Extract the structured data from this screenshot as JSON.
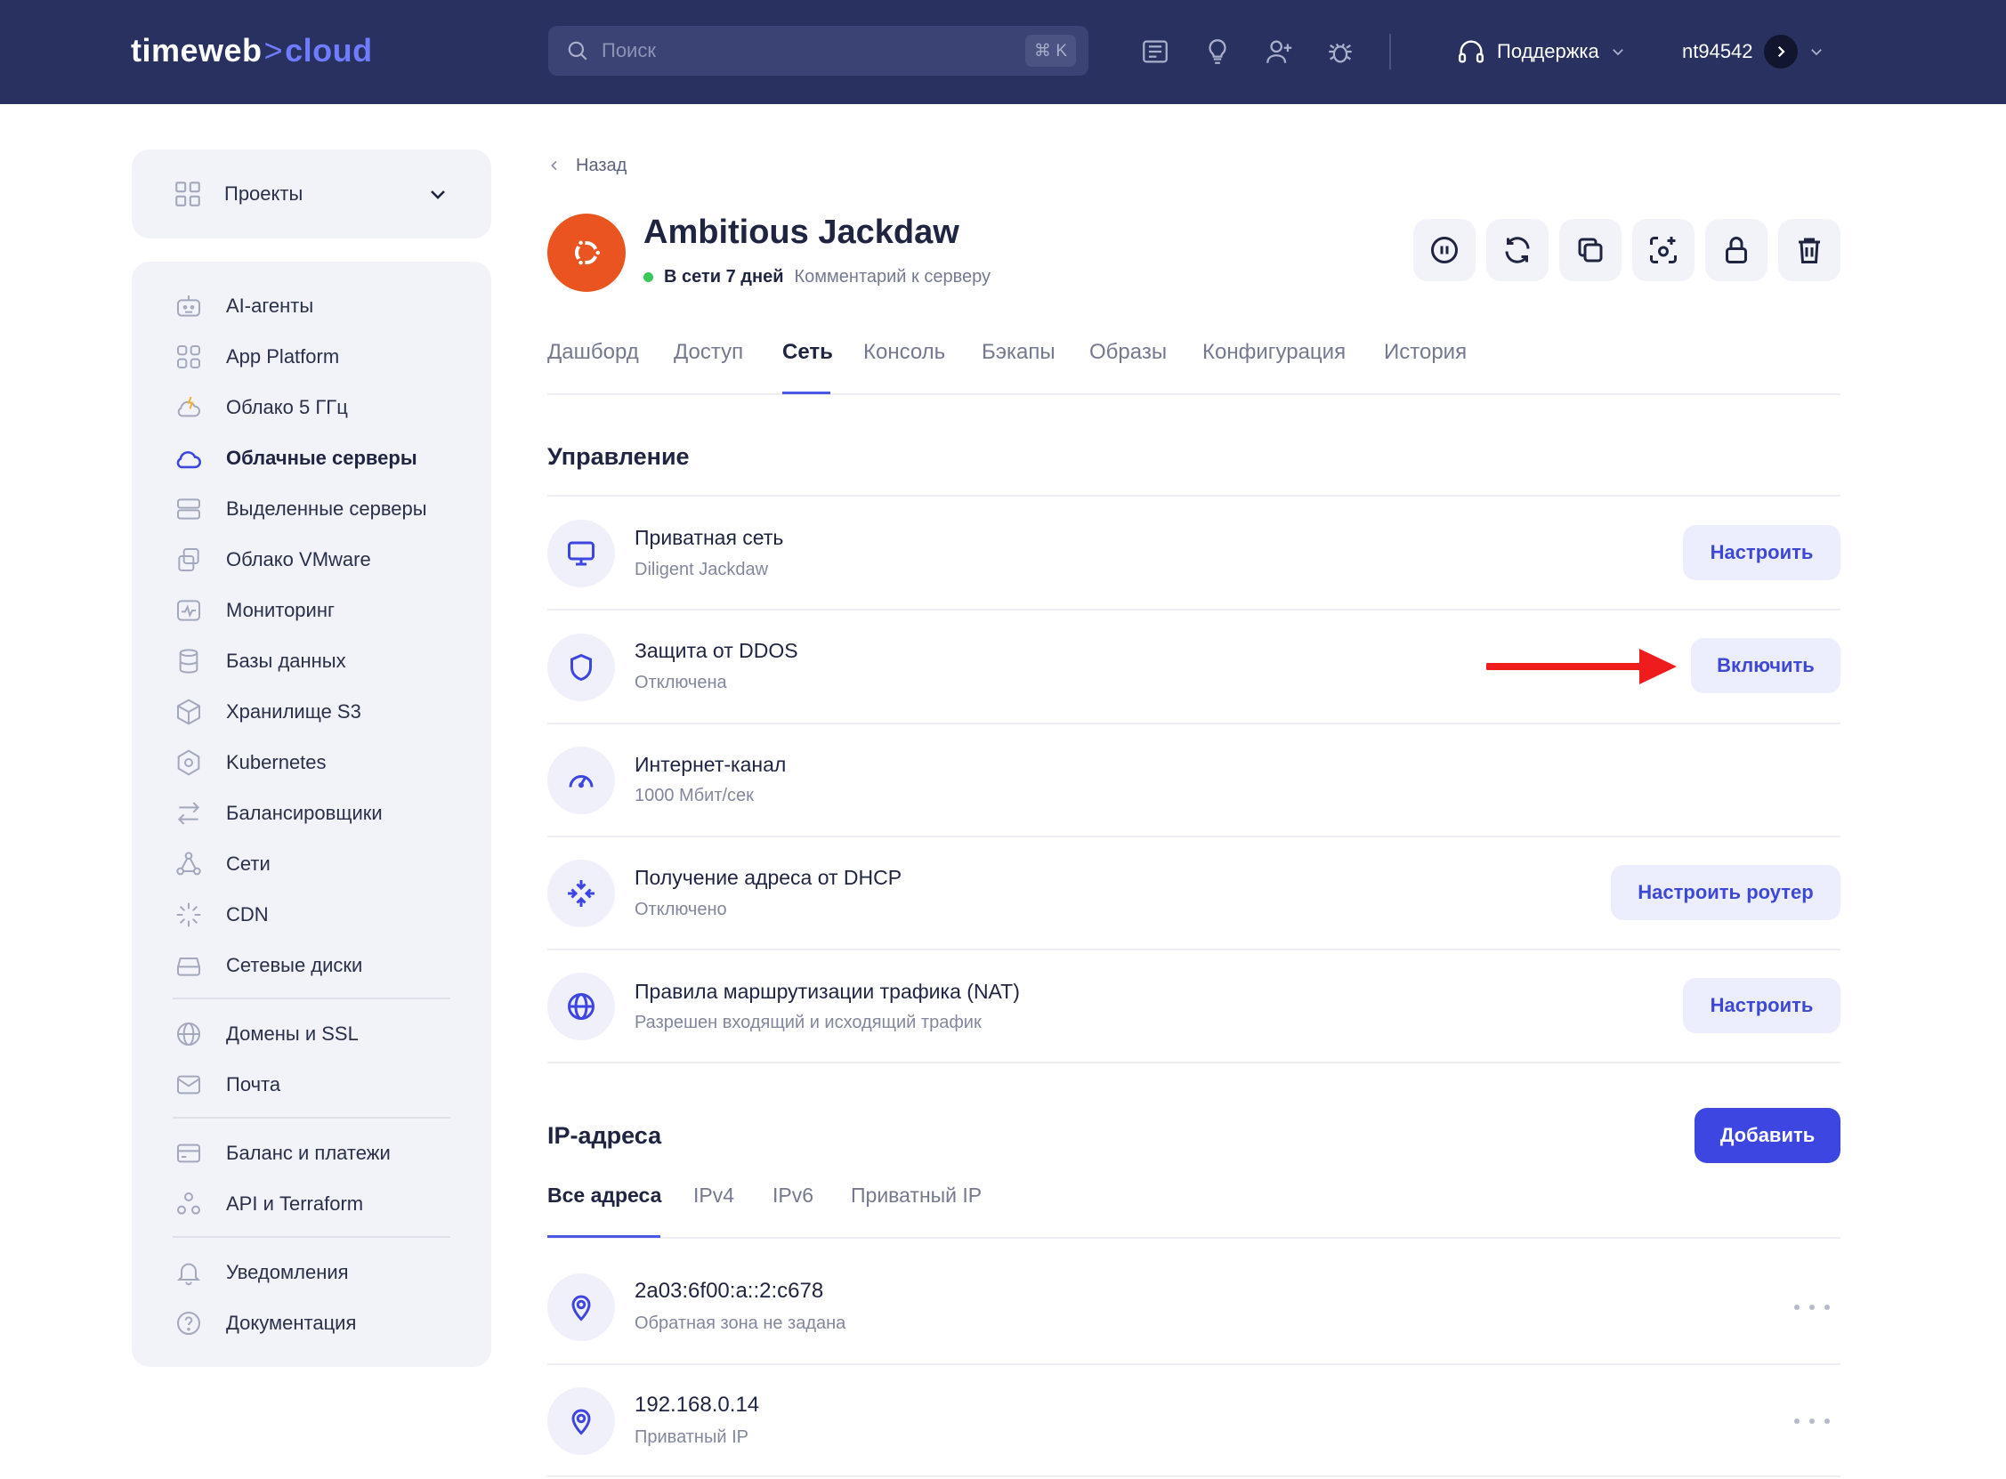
{
  "header": {
    "logo_main": "timeweb",
    "logo_sep": ">",
    "logo_accent": "cloud",
    "search_placeholder": "Поиск",
    "search_shortcut": "⌘ K",
    "support_label": "Поддержка",
    "username": "nt94542"
  },
  "sidebar": {
    "projects_label": "Проекты",
    "items": [
      {
        "label": "AI-агенты"
      },
      {
        "label": "App Platform"
      },
      {
        "label": "Облако 5 ГГц"
      },
      {
        "label": "Облачные серверы"
      },
      {
        "label": "Выделенные серверы"
      },
      {
        "label": "Облако VMware"
      },
      {
        "label": "Мониторинг"
      },
      {
        "label": "Базы данных"
      },
      {
        "label": "Хранилище S3"
      },
      {
        "label": "Kubernetes"
      },
      {
        "label": "Балансировщики"
      },
      {
        "label": "Сети"
      },
      {
        "label": "CDN"
      },
      {
        "label": "Сетевые диски"
      },
      {
        "label": "Домены и SSL"
      },
      {
        "label": "Почта"
      },
      {
        "label": "Баланс и платежи"
      },
      {
        "label": "API и Terraform"
      },
      {
        "label": "Уведомления"
      },
      {
        "label": "Документация"
      }
    ]
  },
  "server": {
    "back_label": "Назад",
    "name": "Ambitious Jackdaw",
    "status": "В сети 7 дней",
    "comment": "Комментарий к серверу"
  },
  "tabs": [
    {
      "label": "Дашборд"
    },
    {
      "label": "Доступ"
    },
    {
      "label": "Сеть"
    },
    {
      "label": "Консоль"
    },
    {
      "label": "Бэкапы"
    },
    {
      "label": "Образы"
    },
    {
      "label": "Конфигурация"
    },
    {
      "label": "История"
    }
  ],
  "management": {
    "title": "Управление",
    "rows": [
      {
        "title": "Приватная сеть",
        "subtitle": "Diligent Jackdaw",
        "button": "Настроить"
      },
      {
        "title": "Защита от DDOS",
        "subtitle": "Отключена",
        "button": "Включить"
      },
      {
        "title": "Интернет-канал",
        "subtitle": "1000 Мбит/сек"
      },
      {
        "title": "Получение адреса от DHCP",
        "subtitle": "Отключено",
        "button": "Настроить роутер"
      },
      {
        "title": "Правила маршрутизации трафика (NAT)",
        "subtitle": "Разрешен входящий и исходящий трафик",
        "button": "Настроить"
      }
    ]
  },
  "ip": {
    "title": "IP-адреса",
    "add_button": "Добавить",
    "tabs": [
      {
        "label": "Все адреса"
      },
      {
        "label": "IPv4"
      },
      {
        "label": "IPv6"
      },
      {
        "label": "Приватный IP"
      }
    ],
    "rows": [
      {
        "address": "2a03:6f00:a::2:c678",
        "note": "Обратная зона не задана"
      },
      {
        "address": "192.168.0.14",
        "note": "Приватный IP"
      }
    ]
  },
  "colors": {
    "header_bg": "#28315f",
    "accent": "#3d46e0",
    "annotation_arrow": "#ee1c1c",
    "online_dot": "#37c75a",
    "os_badge": "#e95420"
  }
}
